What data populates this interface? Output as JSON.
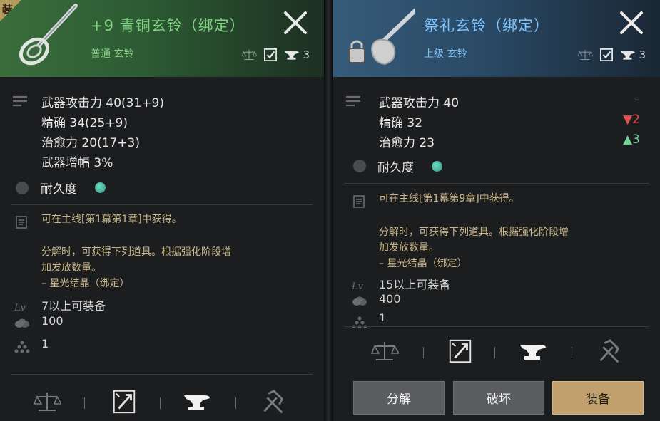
{
  "left": {
    "badge": "装",
    "title": "+9 青铜玄铃（绑定）",
    "subtitle": "普通 玄铃",
    "bind_count": "3",
    "stats": [
      "武器攻击力 40(31+9)",
      "精确 34(25+9)",
      "治愈力 20(17+3)",
      "武器增幅 3%"
    ],
    "durability_label": "耐久度",
    "desc_source": "可在主线[第1幕第1章]中获得。",
    "desc_dismantle": "分解时，可获得下列道具。根据强化阶段增\n加发放数量。\n– 星光结晶（绑定）",
    "req_level": "7以上可装备",
    "req_value": "100",
    "req_weight": "1"
  },
  "right": {
    "title": "祭礼玄铃（绑定）",
    "subtitle": "上级 玄铃",
    "bind_count": "3",
    "stats": [
      "武器攻击力 40",
      "精确 32",
      "治愈力 23"
    ],
    "diffs": [
      "–",
      "▼2",
      "▲3"
    ],
    "durability_label": "耐久度",
    "desc_source": "可在主线[第1幕第9章]中获得。",
    "desc_dismantle": "分解时，可获得下列道具。根据强化阶段增\n加发放数量。\n– 星光结晶（绑定）",
    "req_level": "15以上可装备",
    "req_value": "400",
    "req_weight": "1",
    "buttons": {
      "dismantle": "分解",
      "destroy": "破坏",
      "equip": "装备"
    }
  },
  "colors": {
    "left_header": "#2c5a33",
    "right_header": "#2a4a66",
    "equip_button": "#c2a06e",
    "stat_down": "#e05050",
    "stat_up": "#6fd39a"
  }
}
